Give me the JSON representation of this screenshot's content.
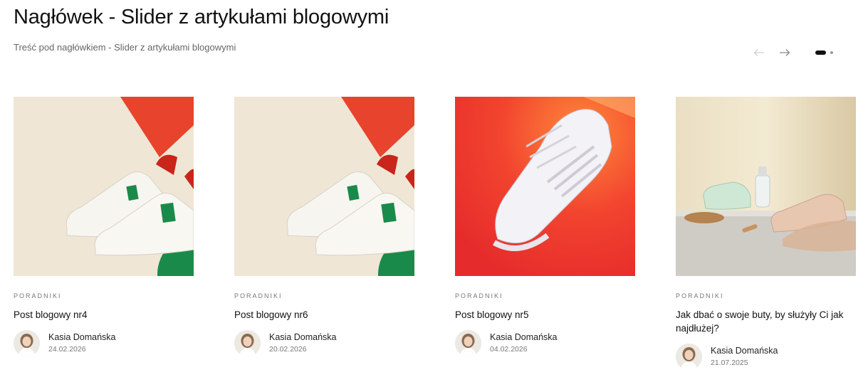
{
  "header": {
    "title": "Nagłówek - Slider z artykułami blogowymi",
    "subtitle": "Treść pod nagłówkiem - Slider z artykułami blogowymi"
  },
  "slider": {
    "prev_icon": "arrow-left-icon",
    "next_icon": "arrow-right-icon",
    "dots_total": 2,
    "dots_active": 1
  },
  "posts": [
    {
      "category": "PORADNIKI",
      "title": "Post blogowy nr4",
      "author": "Kasia Domańska",
      "date": "24.02.2026",
      "image": "white-green-sneakers"
    },
    {
      "category": "PORADNIKI",
      "title": "Post blogowy nr6",
      "author": "Kasia Domańska",
      "date": "20.02.2026",
      "image": "white-green-sneakers"
    },
    {
      "category": "PORADNIKI",
      "title": "Post blogowy nr5",
      "author": "Kasia Domańska",
      "date": "04.02.2026",
      "image": "white-sneaker-red-background"
    },
    {
      "category": "PORADNIKI",
      "title": "Jak dbać o swoje buty, by służyły Ci jak najdłużej?",
      "author": "Kasia Domańska",
      "date": "21.07.2025",
      "image": "sneakers-cleaning-kit"
    }
  ],
  "colors": {
    "accent_red": "#e8432c",
    "accent_green": "#1a8a4a",
    "text": "#111111",
    "muted": "#777777"
  }
}
